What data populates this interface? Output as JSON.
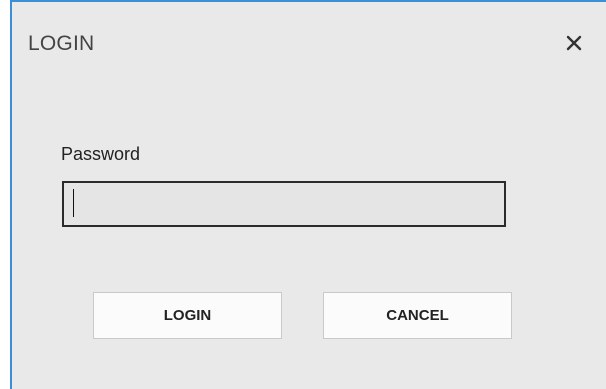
{
  "dialog": {
    "title": "LOGIN",
    "close_icon": "close-icon",
    "password": {
      "label": "Password",
      "value": "",
      "placeholder": ""
    },
    "buttons": {
      "login_label": "LOGIN",
      "cancel_label": "CANCEL"
    }
  },
  "colors": {
    "window_border": "#3a8fd6",
    "background": "#e9e9e9"
  }
}
